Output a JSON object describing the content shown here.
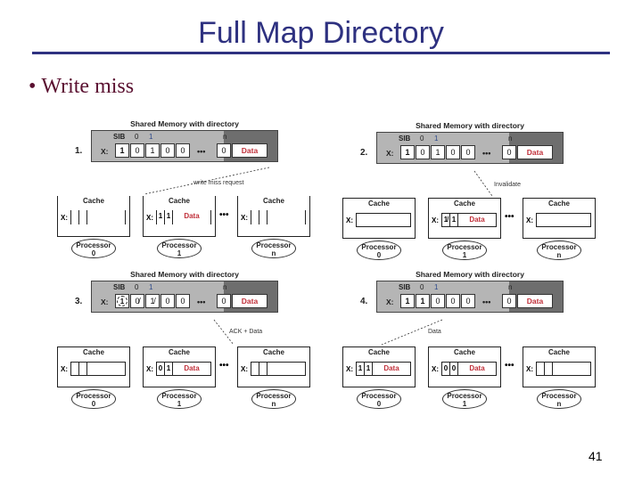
{
  "slide": {
    "title": "Full Map Directory",
    "bullet": "Write miss",
    "bullet_symbol": "•",
    "page_number": "41"
  },
  "colors": {
    "title": "#2e3180",
    "bullet": "#5a1030",
    "data_text": "#c0303a",
    "memory_bg": "#b5b5b5",
    "memory_dark": "#6e6e6e"
  },
  "diagram": {
    "memory_title": "Shared Memory with directory",
    "sib_label": "SIB",
    "col0": "0",
    "col1": "1",
    "coln": "n",
    "x_label": "X:",
    "ellipsis": "•••",
    "data_label": "Data",
    "cache_label": "Cache",
    "processor_label": "Processor",
    "panels": [
      {
        "step": "1.",
        "bits": [
          "1",
          "0",
          "1",
          "0",
          "0"
        ],
        "bit_n": "0",
        "message": "write miss request",
        "caches": [
          {
            "bits": [
              "",
              ""
            ],
            "data": "",
            "proc_id": "0"
          },
          {
            "bits": [
              "1",
              "1"
            ],
            "data": "Data",
            "proc_id": "1"
          },
          {
            "bits": [
              "",
              ""
            ],
            "data": "",
            "proc_id": "n"
          }
        ]
      },
      {
        "step": "2.",
        "bits": [
          "1",
          "0",
          "1",
          "0",
          "0"
        ],
        "bit_n": "0",
        "message": "Invalidate",
        "caches": [
          {
            "bits": [
              "",
              ""
            ],
            "data": "",
            "proc_id": "0"
          },
          {
            "bits": [
              "1̸",
              "1"
            ],
            "data": "Data",
            "proc_id": "1"
          },
          {
            "bits": [
              "",
              ""
            ],
            "data": "",
            "proc_id": "n"
          }
        ]
      },
      {
        "step": "3.",
        "bits": [
          "1",
          "0̸",
          "1̸",
          "0",
          "0"
        ],
        "bit_n": "0",
        "message": "ACK + Data",
        "caches": [
          {
            "bits": [
              "",
              ""
            ],
            "data": "",
            "proc_id": "0"
          },
          {
            "bits": [
              "0",
              "1"
            ],
            "data": "Data",
            "proc_id": "1"
          },
          {
            "bits": [
              "",
              ""
            ],
            "data": "",
            "proc_id": "n"
          }
        ]
      },
      {
        "step": "4.",
        "bits": [
          "1",
          "1",
          "0",
          "0",
          "0"
        ],
        "bit_n": "0",
        "message": "Data",
        "caches": [
          {
            "bits": [
              "1",
              "1"
            ],
            "data": "Data",
            "proc_id": "0"
          },
          {
            "bits": [
              "0",
              "0"
            ],
            "data": "Data",
            "proc_id": "1"
          },
          {
            "bits": [
              "",
              ""
            ],
            "data": "",
            "proc_id": "n"
          }
        ]
      }
    ]
  }
}
